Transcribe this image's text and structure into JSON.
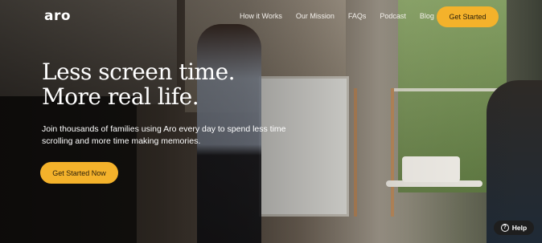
{
  "brand": {
    "logo_text": "aro"
  },
  "nav": {
    "links": [
      {
        "label": "How it Works"
      },
      {
        "label": "Our Mission"
      },
      {
        "label": "FAQs"
      },
      {
        "label": "Podcast"
      },
      {
        "label": "Blog"
      }
    ],
    "cta_label": "Get Started"
  },
  "hero": {
    "headline_line1": "Less screen time.",
    "headline_line2": "More real life.",
    "subtext": "Join thousands of families using Aro every day to spend less time scrolling and more time making memories.",
    "cta_label": "Get Started Now"
  },
  "help": {
    "label": "Help",
    "icon": "question-circle-icon"
  },
  "colors": {
    "accent": "#f4b22b",
    "text_light": "#ffffff",
    "help_bg": "#1e1e1e"
  }
}
